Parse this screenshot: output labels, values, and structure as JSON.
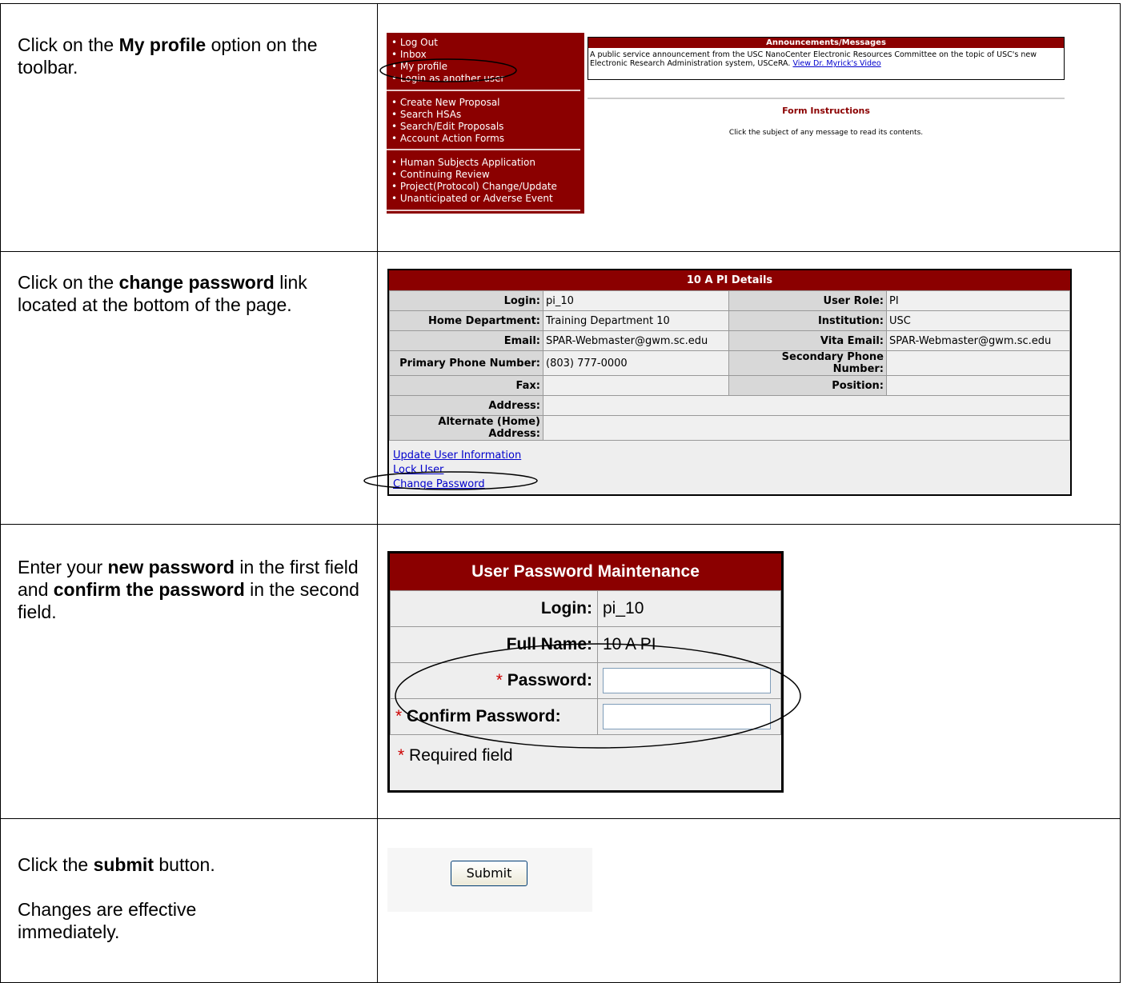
{
  "steps": [
    {
      "pre": "Click on the ",
      "bold": "My profile",
      "post": " option on the toolbar."
    },
    {
      "pre": "Click on the ",
      "bold": "change password",
      "post": " link located at the bottom of the page."
    },
    {
      "pre": "Enter your ",
      "bold": "new password",
      "mid": " in the first field and ",
      "bold2": "confirm the password",
      "post": " in the second field."
    },
    {
      "pre": "Click the ",
      "bold": "submit",
      "post": " button.",
      "extra": "Changes are effective immediately."
    }
  ],
  "menu": {
    "group1": [
      "• Log Out",
      "• Inbox",
      "• My profile",
      "• Login as another user"
    ],
    "group2": [
      "• Create New Proposal",
      "• Search HSAs",
      "• Search/Edit Proposals",
      "• Account Action Forms"
    ],
    "group3": [
      "• Human Subjects Application",
      "• Continuing Review",
      "• Project(Protocol) Change/Update",
      "• Unanticipated or Adverse Event"
    ]
  },
  "announcements": {
    "title": "Announcements/Messages",
    "text": "A public service announcement from the USC NanoCenter Electronic Resources Committee on the topic of USC's new Electronic Research Administration system, USCeRA.",
    "link": "View Dr. Myrick's Video"
  },
  "form_instructions": {
    "title": "Form Instructions",
    "text": "Click the subject of any message to read its contents."
  },
  "details": {
    "title": "10 A PI Details",
    "rows": [
      {
        "k1": "Login:",
        "v1": "pi_10",
        "k2": "User Role:",
        "v2": "PI"
      },
      {
        "k1": "Home Department:",
        "v1": "Training Department 10",
        "k2": "Institution:",
        "v2": "USC"
      },
      {
        "k1": "Email:",
        "v1": "SPAR-Webmaster@gwm.sc.edu",
        "k2": "Vita Email:",
        "v2": "SPAR-Webmaster@gwm.sc.edu"
      },
      {
        "k1": "Primary Phone Number:",
        "v1": "(803) 777-0000",
        "k2": "Secondary Phone Number:",
        "v2": ""
      },
      {
        "k1": "Fax:",
        "v1": "",
        "k2": "Position:",
        "v2": ""
      }
    ],
    "address_label": "Address:",
    "address_value": "",
    "alt_address_label": "Alternate (Home) Address:",
    "alt_address_value": "",
    "links": [
      "Update User Information",
      "Lock User",
      "Change Password"
    ]
  },
  "password_form": {
    "title": "User Password Maintenance",
    "login_label": "Login:",
    "login_value": "pi_10",
    "fullname_label": "Full Name:",
    "fullname_value": "10 A PI",
    "password_label": "Password:",
    "confirm_label": "Confirm Password:",
    "required_star": "*",
    "required_text": "Required field",
    "password_value": "",
    "confirm_value": ""
  },
  "submit_label": "Submit",
  "colors": {
    "header_red": "#8b0000",
    "link_blue": "#0000cc"
  }
}
